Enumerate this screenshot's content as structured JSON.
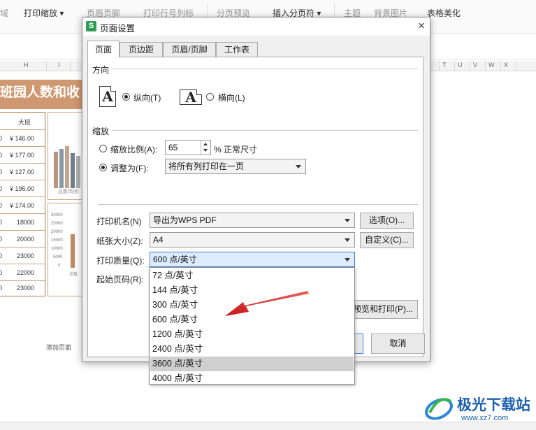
{
  "ribbon": {
    "items": [
      {
        "label": "域",
        "dim": true
      },
      {
        "label": "打印缩放",
        "dim": false
      },
      {
        "label": "页眉页脚",
        "dim": true
      },
      {
        "label": "打印行号列标",
        "dim": true
      },
      {
        "label": "分页预览",
        "dim": true
      },
      {
        "label": "插入分页符",
        "dim": false
      },
      {
        "label": "主题",
        "dim": true
      },
      {
        "label": "背景图片",
        "dim": true
      },
      {
        "label": "表格美化",
        "dim": false
      }
    ]
  },
  "sheet": {
    "columns": [
      "H",
      "I",
      "T",
      "U",
      "V",
      "W",
      "X"
    ],
    "title": "班园人数和收",
    "left_col": [
      "0",
      "0",
      "0",
      "0",
      "0",
      "0",
      "0",
      "0",
      "0",
      "0"
    ],
    "header": "大班",
    "money": [
      "¥ 146.00",
      "¥ 177.00",
      "¥ 127.00",
      "¥ 195.00",
      "¥ 174.00"
    ],
    "numbers": [
      "18000",
      "20000",
      "23000",
      "22000",
      "23000"
    ],
    "chart_axis": [
      "30000",
      "25000",
      "20000",
      "15000",
      "10000",
      "5000",
      "0"
    ],
    "chart_caption_1": "总数/均价",
    "chart_caption_2": "总数",
    "add_page_label": "添加页面"
  },
  "dialog": {
    "logo": "S",
    "title": "页面设置",
    "close": "×",
    "tabs": [
      "页面",
      "页边距",
      "页眉/页脚",
      "工作表"
    ],
    "active_tab": 0,
    "orientation": {
      "section": "方向",
      "portrait_label": "纵向(T)",
      "landscape_label": "横向(L)",
      "icon_letter": "A",
      "selected": "portrait"
    },
    "scaling": {
      "section": "缩放",
      "scale_label": "缩放比例(A):",
      "scale_value": "65",
      "scale_suffix": "% 正常尺寸",
      "fit_label": "调整为(F):",
      "fit_value": "将所有列打印在一页",
      "selected": "fit"
    },
    "printer_label": "打印机名(N)",
    "printer_value": "导出为WPS PDF",
    "options_button": "选项(O)...",
    "paper_label": "纸张大小(Z):",
    "paper_value": "A4",
    "custom_button": "自定义(C)...",
    "quality_label": "打印质量(Q):",
    "quality_value": "600 点/英寸",
    "start_page_label": "起始页码(R):",
    "preview_print_button": "预览和打印(P)...",
    "cancel_button": "取消"
  },
  "quality_dropdown": {
    "options": [
      "72 点/英寸",
      "144 点/英寸",
      "300 点/英寸",
      "600 点/英寸",
      "1200 点/英寸",
      "2400 点/英寸",
      "3600 点/英寸",
      "4000 点/英寸"
    ],
    "highlighted": "3600 点/英寸"
  },
  "annotation": {
    "arrow_color": "#d42525"
  },
  "watermark": {
    "name": "极光下载站",
    "url": "www.xz7.com"
  },
  "colors": {
    "title_fill": "#cf9870",
    "accent_blue": "#3c7fd6",
    "wps_green": "#2f9d57"
  }
}
